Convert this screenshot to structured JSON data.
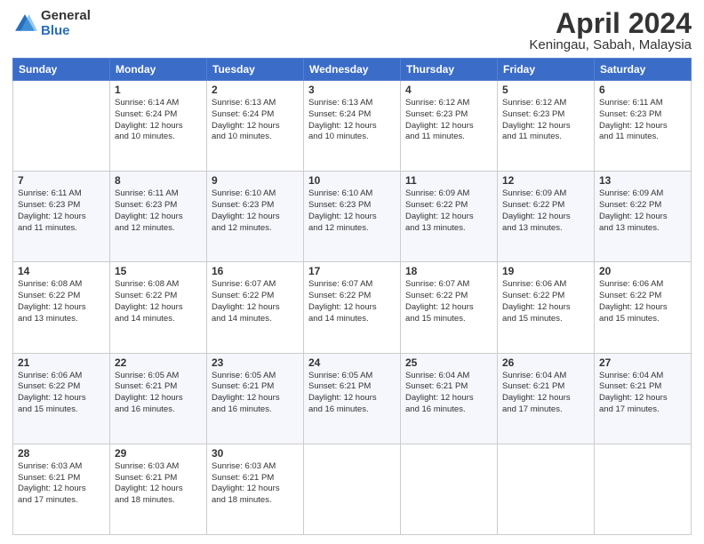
{
  "header": {
    "logo_general": "General",
    "logo_blue": "Blue",
    "title": "April 2024",
    "location": "Keningau, Sabah, Malaysia"
  },
  "days_of_week": [
    "Sunday",
    "Monday",
    "Tuesday",
    "Wednesday",
    "Thursday",
    "Friday",
    "Saturday"
  ],
  "weeks": [
    [
      {
        "day": "",
        "info": ""
      },
      {
        "day": "1",
        "info": "Sunrise: 6:14 AM\nSunset: 6:24 PM\nDaylight: 12 hours\nand 10 minutes."
      },
      {
        "day": "2",
        "info": "Sunrise: 6:13 AM\nSunset: 6:24 PM\nDaylight: 12 hours\nand 10 minutes."
      },
      {
        "day": "3",
        "info": "Sunrise: 6:13 AM\nSunset: 6:24 PM\nDaylight: 12 hours\nand 10 minutes."
      },
      {
        "day": "4",
        "info": "Sunrise: 6:12 AM\nSunset: 6:23 PM\nDaylight: 12 hours\nand 11 minutes."
      },
      {
        "day": "5",
        "info": "Sunrise: 6:12 AM\nSunset: 6:23 PM\nDaylight: 12 hours\nand 11 minutes."
      },
      {
        "day": "6",
        "info": "Sunrise: 6:11 AM\nSunset: 6:23 PM\nDaylight: 12 hours\nand 11 minutes."
      }
    ],
    [
      {
        "day": "7",
        "info": "Sunrise: 6:11 AM\nSunset: 6:23 PM\nDaylight: 12 hours\nand 11 minutes."
      },
      {
        "day": "8",
        "info": "Sunrise: 6:11 AM\nSunset: 6:23 PM\nDaylight: 12 hours\nand 12 minutes."
      },
      {
        "day": "9",
        "info": "Sunrise: 6:10 AM\nSunset: 6:23 PM\nDaylight: 12 hours\nand 12 minutes."
      },
      {
        "day": "10",
        "info": "Sunrise: 6:10 AM\nSunset: 6:23 PM\nDaylight: 12 hours\nand 12 minutes."
      },
      {
        "day": "11",
        "info": "Sunrise: 6:09 AM\nSunset: 6:22 PM\nDaylight: 12 hours\nand 13 minutes."
      },
      {
        "day": "12",
        "info": "Sunrise: 6:09 AM\nSunset: 6:22 PM\nDaylight: 12 hours\nand 13 minutes."
      },
      {
        "day": "13",
        "info": "Sunrise: 6:09 AM\nSunset: 6:22 PM\nDaylight: 12 hours\nand 13 minutes."
      }
    ],
    [
      {
        "day": "14",
        "info": "Sunrise: 6:08 AM\nSunset: 6:22 PM\nDaylight: 12 hours\nand 13 minutes."
      },
      {
        "day": "15",
        "info": "Sunrise: 6:08 AM\nSunset: 6:22 PM\nDaylight: 12 hours\nand 14 minutes."
      },
      {
        "day": "16",
        "info": "Sunrise: 6:07 AM\nSunset: 6:22 PM\nDaylight: 12 hours\nand 14 minutes."
      },
      {
        "day": "17",
        "info": "Sunrise: 6:07 AM\nSunset: 6:22 PM\nDaylight: 12 hours\nand 14 minutes."
      },
      {
        "day": "18",
        "info": "Sunrise: 6:07 AM\nSunset: 6:22 PM\nDaylight: 12 hours\nand 15 minutes."
      },
      {
        "day": "19",
        "info": "Sunrise: 6:06 AM\nSunset: 6:22 PM\nDaylight: 12 hours\nand 15 minutes."
      },
      {
        "day": "20",
        "info": "Sunrise: 6:06 AM\nSunset: 6:22 PM\nDaylight: 12 hours\nand 15 minutes."
      }
    ],
    [
      {
        "day": "21",
        "info": "Sunrise: 6:06 AM\nSunset: 6:22 PM\nDaylight: 12 hours\nand 15 minutes."
      },
      {
        "day": "22",
        "info": "Sunrise: 6:05 AM\nSunset: 6:21 PM\nDaylight: 12 hours\nand 16 minutes."
      },
      {
        "day": "23",
        "info": "Sunrise: 6:05 AM\nSunset: 6:21 PM\nDaylight: 12 hours\nand 16 minutes."
      },
      {
        "day": "24",
        "info": "Sunrise: 6:05 AM\nSunset: 6:21 PM\nDaylight: 12 hours\nand 16 minutes."
      },
      {
        "day": "25",
        "info": "Sunrise: 6:04 AM\nSunset: 6:21 PM\nDaylight: 12 hours\nand 16 minutes."
      },
      {
        "day": "26",
        "info": "Sunrise: 6:04 AM\nSunset: 6:21 PM\nDaylight: 12 hours\nand 17 minutes."
      },
      {
        "day": "27",
        "info": "Sunrise: 6:04 AM\nSunset: 6:21 PM\nDaylight: 12 hours\nand 17 minutes."
      }
    ],
    [
      {
        "day": "28",
        "info": "Sunrise: 6:03 AM\nSunset: 6:21 PM\nDaylight: 12 hours\nand 17 minutes."
      },
      {
        "day": "29",
        "info": "Sunrise: 6:03 AM\nSunset: 6:21 PM\nDaylight: 12 hours\nand 18 minutes."
      },
      {
        "day": "30",
        "info": "Sunrise: 6:03 AM\nSunset: 6:21 PM\nDaylight: 12 hours\nand 18 minutes."
      },
      {
        "day": "",
        "info": ""
      },
      {
        "day": "",
        "info": ""
      },
      {
        "day": "",
        "info": ""
      },
      {
        "day": "",
        "info": ""
      }
    ]
  ]
}
